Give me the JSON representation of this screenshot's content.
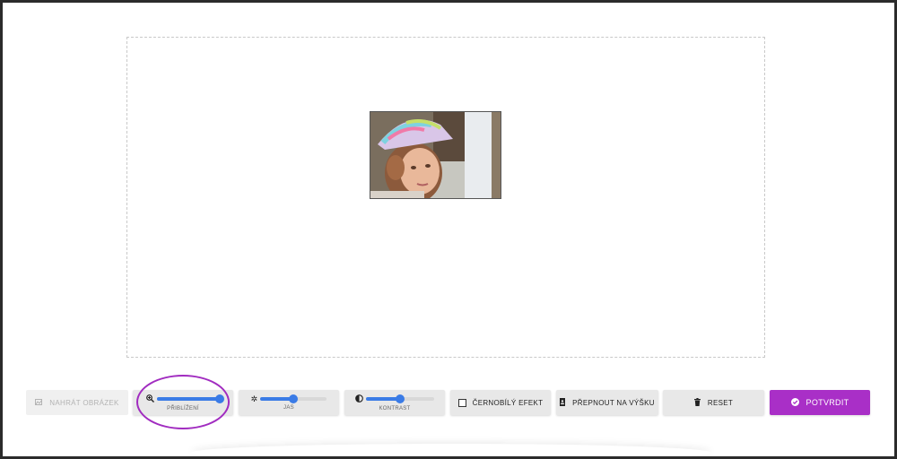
{
  "toolbar": {
    "upload_label": "NAHRÁT OBRÁZEK",
    "zoom_label": "PŘIBLÍŽENÍ",
    "zoom_value": 1.0,
    "brightness_label": "JAS",
    "brightness_value": 0.5,
    "contrast_label": "KONTRAST",
    "contrast_value": 0.5,
    "bw_label": "ČERNOBÍLÝ EFEKT",
    "bw_checked": false,
    "orientation_label": "PŘEPNOUT NA VÝŠKU",
    "reset_label": "RESET",
    "confirm_label": "POTVRDIT"
  },
  "icons": {
    "upload": "image-icon",
    "zoom": "zoom-in-icon",
    "brightness": "brightness-icon",
    "contrast": "contrast-icon",
    "orientation": "portrait-icon",
    "reset": "trash-icon",
    "confirm": "check-circle-icon"
  },
  "colors": {
    "accent": "#a92fc7",
    "slider": "#3a7be6",
    "highlight_circle": "#a12cc0"
  }
}
